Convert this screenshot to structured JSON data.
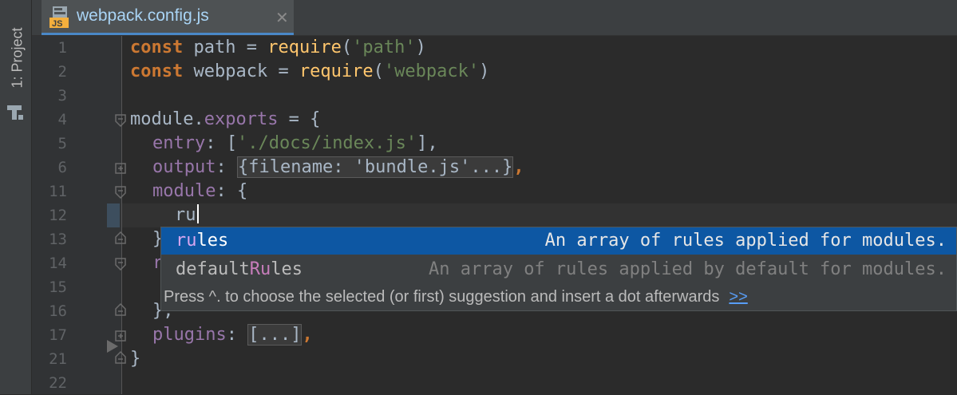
{
  "toolwindow": {
    "project_label": "1: Project"
  },
  "tab": {
    "title": "webpack.config.js",
    "file_badge": "JS",
    "close": "✕"
  },
  "gutter": {
    "line_numbers": [
      "1",
      "2",
      "3",
      "4",
      "5",
      "6",
      "11",
      "12",
      "13",
      "14",
      "15",
      "16",
      "17",
      "21",
      "22"
    ]
  },
  "code": {
    "l1": {
      "kw": "const",
      "a": " path = ",
      "fn": "require",
      "b": "(",
      "str": "'path'",
      "c": ")"
    },
    "l2": {
      "kw": "const",
      "a": " webpack = ",
      "fn": "require",
      "b": "(",
      "str": "'webpack'",
      "c": ")"
    },
    "l4": {
      "a": "module.",
      "prop": "exports",
      "b": " = {"
    },
    "l5": {
      "prop": "entry",
      "a": ": [",
      "str": "'./docs/index.js'",
      "b": "],"
    },
    "l6": {
      "prop": "output",
      "a": ": ",
      "fold": "{filename: 'bundle.js'...}",
      "b": ","
    },
    "l11": {
      "prop": "module",
      "a": ": {"
    },
    "l12": {
      "text": "ru"
    },
    "l13": {
      "text": "}"
    },
    "l14": {
      "text": "r"
    },
    "l16": {
      "text": "},"
    },
    "l17": {
      "prop": "plugins",
      "a": ": ",
      "fold": "[...]",
      "b": ","
    },
    "l21": {
      "text": "}"
    }
  },
  "completion": {
    "items": [
      {
        "prefix": "ru",
        "rest": "les",
        "desc": "An array of rules applied for modules.",
        "selected": true
      },
      {
        "before": "default",
        "match": "Ru",
        "rest": "les",
        "desc": "An array of rules applied by default for modules.",
        "selected": false
      }
    ],
    "hint": "Press ^. to choose the selected (or first) suggestion and insert a dot afterwards",
    "hint_link": ">>"
  }
}
